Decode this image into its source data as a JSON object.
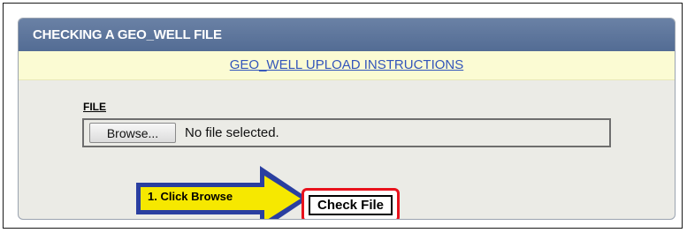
{
  "panel": {
    "title": "CHECKING A GEO_WELL FILE",
    "instructions_link": "GEO_WELL UPLOAD INSTRUCTIONS"
  },
  "file_field": {
    "label": "FILE",
    "browse_label": "Browse...",
    "status": "No file selected."
  },
  "annotation": {
    "text": "1. Click Browse",
    "arrow_fill": "#2a3fa0",
    "arrow_inner": "#f6e800"
  },
  "actions": {
    "check_file_label": "Check File",
    "highlight_color": "#e8121c"
  }
}
